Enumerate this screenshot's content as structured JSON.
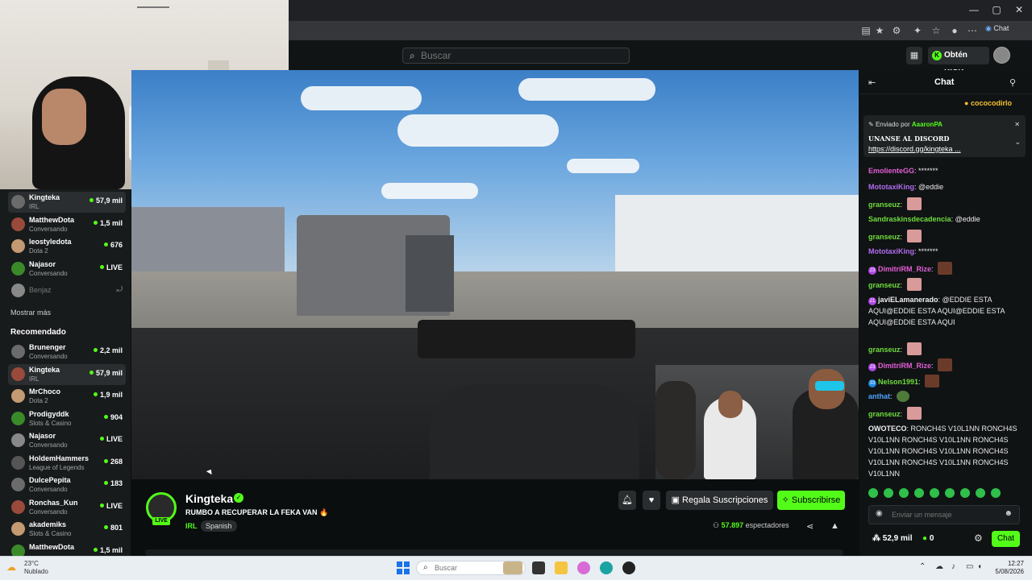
{
  "browser": {
    "chat_label": "Chat"
  },
  "header": {
    "search_placeholder": "Buscar",
    "kicks_label": "Obtén KICKs"
  },
  "sidebar": {
    "following": [
      {
        "name": "Kingteka",
        "category": "IRL",
        "viewers": "57,9 mil",
        "selected": true
      },
      {
        "name": "MatthewDota",
        "category": "Conversando",
        "viewers": "1,5 mil"
      },
      {
        "name": "leostyledota",
        "category": "Dota 2",
        "viewers": "676"
      },
      {
        "name": "Najasor",
        "category": "Conversando",
        "viewers": "LIVE"
      },
      {
        "name": "Benjaz",
        "category": "",
        "viewers": "",
        "offline": true
      }
    ],
    "show_more": "Mostrar más",
    "recommended_title": "Recomendado",
    "recommended": [
      {
        "name": "Brunenger",
        "category": "Conversando",
        "viewers": "2,2 mil"
      },
      {
        "name": "Kingteka",
        "category": "IRL",
        "viewers": "57,9 mil",
        "selected": true
      },
      {
        "name": "MrChoco",
        "category": "Dota 2",
        "viewers": "1,9 mil"
      },
      {
        "name": "Prodigyddk",
        "category": "Slots & Casino",
        "viewers": "904"
      },
      {
        "name": "Najasor",
        "category": "Conversando",
        "viewers": "LIVE"
      },
      {
        "name": "HoldemHammers",
        "category": "League of Legends",
        "viewers": "268"
      },
      {
        "name": "DulcePepita",
        "category": "Conversando",
        "viewers": "183"
      },
      {
        "name": "Ronchas_Kun",
        "category": "Conversando",
        "viewers": "LIVE"
      },
      {
        "name": "akademiks",
        "category": "Slots & Casino",
        "viewers": "801"
      },
      {
        "name": "MatthewDota",
        "category": "",
        "viewers": "1,5 mil"
      }
    ]
  },
  "stream": {
    "streamer": "Kingteka",
    "live_label": "LIVE",
    "title": "RUMBO A RECUPERAR LA FEKA VAN 🔥",
    "category": "IRL",
    "tag": "Spanish",
    "gift_label": "Regala Suscripciones",
    "subscribe_label": "Subscribirse",
    "viewers_count": "57.897",
    "viewers_label": "espectadores"
  },
  "chat": {
    "title": "Chat",
    "gift_user": "cococodirlo",
    "pinned_by_label": "Enviado por",
    "pinned_by_user": "AaaronPA",
    "pinned_message": "UNANSE AL DISCORD",
    "pinned_link": "https://discord.gg/kingteka",
    "pinned_more": "...",
    "messages": [
      {
        "user": "EmolienteGG",
        "color": "#e35ed6",
        "text": "*******"
      },
      {
        "user": "MototaxiKing",
        "color": "#b06cf0",
        "text": "@eddie"
      },
      {
        "user": "granseuz",
        "color": "#6fdd3c",
        "text": ""
      },
      {
        "user": "Sandraskinsdecadencia",
        "color": "#6fdd3c",
        "text": "@eddie"
      },
      {
        "user": "granseuz",
        "color": "#6fdd3c",
        "text": ""
      },
      {
        "user": "MototaxiKing",
        "color": "#b06cf0",
        "text": "*******"
      },
      {
        "user": "DimitriRM_Rize",
        "color": "#e35ed6",
        "text": "",
        "badge": "23"
      },
      {
        "user": "granseuz",
        "color": "#6fdd3c",
        "text": ""
      },
      {
        "user": "javiELamanerado",
        "color": "#f0f0f0",
        "text": "@EDDIE ESTA AQUI@EDDIE ESTA AQUI@EDDIE ESTA AQUI@EDDIE ESTA AQUI",
        "badge": "21"
      },
      {
        "user": "granseuz",
        "color": "#6fdd3c",
        "text": ""
      },
      {
        "user": "DimitriRM_Rize",
        "color": "#e35ed6",
        "text": "",
        "badge": "23"
      },
      {
        "user": "Nelson1991",
        "color": "#6fdd3c",
        "text": "",
        "badge": "33"
      },
      {
        "user": "anthat",
        "color": "#4ea3ff",
        "text": ""
      },
      {
        "user": "granseuz",
        "color": "#6fdd3c",
        "text": ""
      },
      {
        "user": "OWOTECO",
        "color": "#f0f0f0",
        "text": "RONCH4S V10L1NN RONCH4S V10L1NN RONCH4S V10L1NN RONCH4S V10L1NN RONCH4S V10L1NN RONCH4S V10L1NN RONCH4S V10L1NN RONCH4S V10L1NN"
      }
    ],
    "input_placeholder": "Enviar un mensaje",
    "points": "52,9 mil",
    "kicks": "0",
    "send_label": "Chat"
  },
  "taskbar": {
    "temp": "23°C",
    "weather": "Nublado",
    "search_placeholder": "Buscar",
    "time": "12:27",
    "date": "5/08/2026"
  }
}
